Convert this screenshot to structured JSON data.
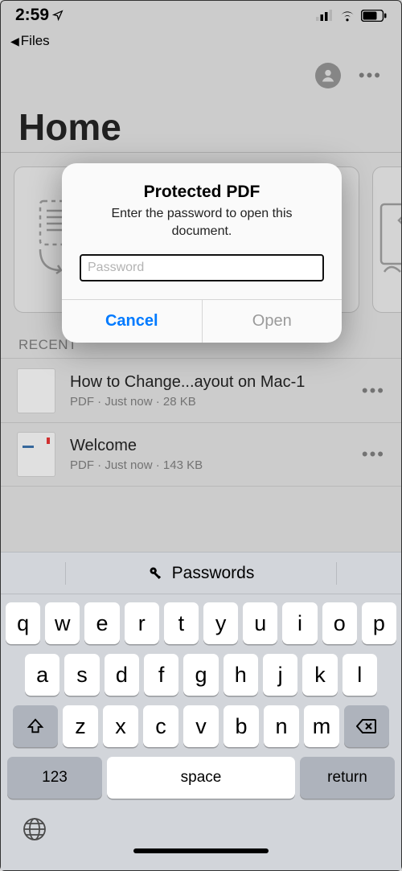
{
  "statusbar": {
    "time": "2:59"
  },
  "backrow": {
    "label": "Files"
  },
  "page": {
    "title": "Home"
  },
  "recent": {
    "header": "RECENT",
    "items": [
      {
        "title": "How to Change...ayout on Mac-1",
        "kind": "PDF",
        "when": "Just now",
        "size": "28 KB"
      },
      {
        "title": "Welcome",
        "kind": "PDF",
        "when": "Just now",
        "size": "143 KB"
      }
    ],
    "meta_sep": "  ·  "
  },
  "alert": {
    "title": "Protected PDF",
    "message": "Enter the password to open this document.",
    "placeholder": "Password",
    "cancel": "Cancel",
    "open": "Open"
  },
  "keyboard": {
    "suggestion": "Passwords",
    "row1": [
      "q",
      "w",
      "e",
      "r",
      "t",
      "y",
      "u",
      "i",
      "o",
      "p"
    ],
    "row2": [
      "a",
      "s",
      "d",
      "f",
      "g",
      "h",
      "j",
      "k",
      "l"
    ],
    "row3": [
      "z",
      "x",
      "c",
      "v",
      "b",
      "n",
      "m"
    ],
    "numbers": "123",
    "space": "space",
    "return": "return"
  }
}
